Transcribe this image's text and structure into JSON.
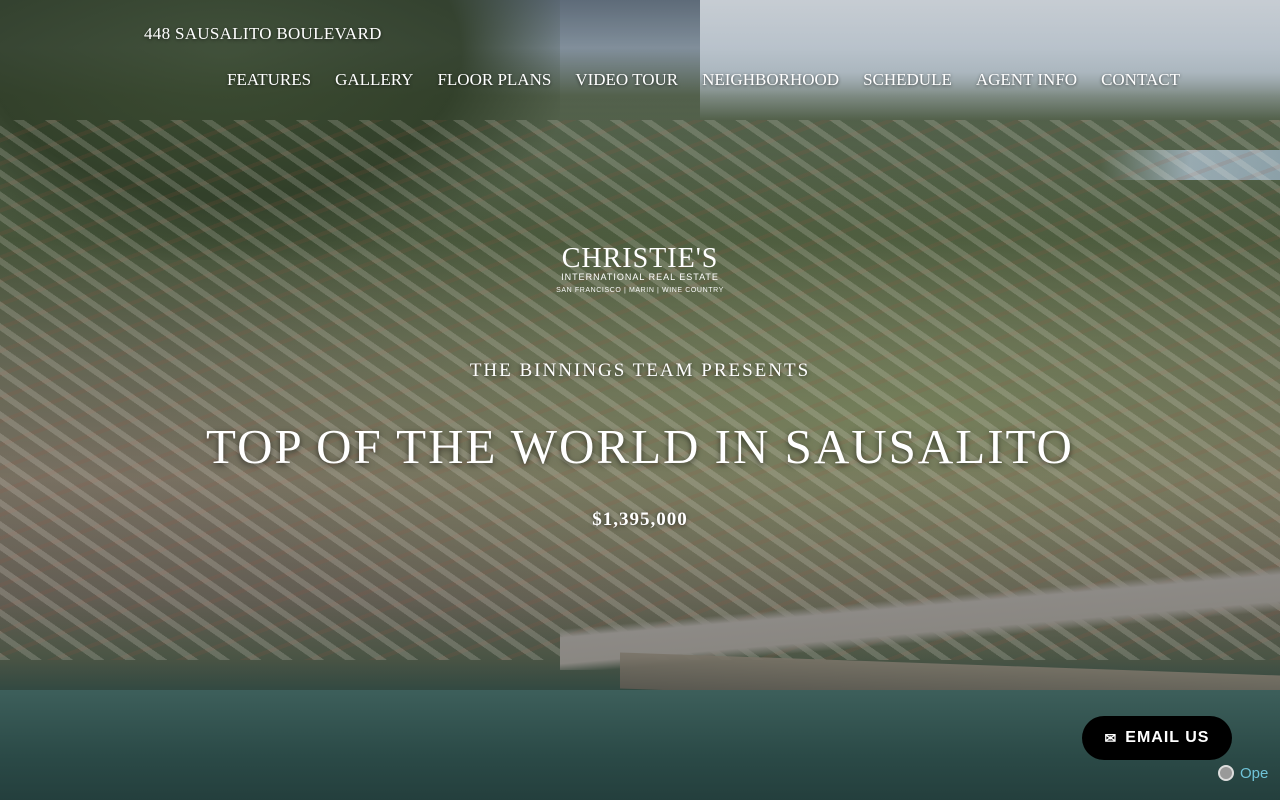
{
  "site": {
    "title": "448 SAUSALITO BOULEVARD"
  },
  "nav": {
    "items": [
      {
        "label": "FEATURES"
      },
      {
        "label": "GALLERY"
      },
      {
        "label": "FLOOR PLANS"
      },
      {
        "label": "VIDEO TOUR"
      },
      {
        "label": "NEIGHBORHOOD"
      },
      {
        "label": "SCHEDULE"
      },
      {
        "label": "AGENT INFO"
      },
      {
        "label": "CONTACT"
      }
    ]
  },
  "logo": {
    "brand": "CHRISTIE'S",
    "subtitle": "INTERNATIONAL REAL ESTATE",
    "regions": "SAN FRANCISCO | MARIN | WINE COUNTRY"
  },
  "hero": {
    "presents": "THE BINNINGS TEAM PRESENTS",
    "headline": "TOP OF THE WORLD IN SAUSALITO",
    "price": "$1,395,000"
  },
  "email_button": {
    "icon": "envelope-icon",
    "label": "EMAIL US"
  },
  "badge": {
    "label": "Ope"
  }
}
